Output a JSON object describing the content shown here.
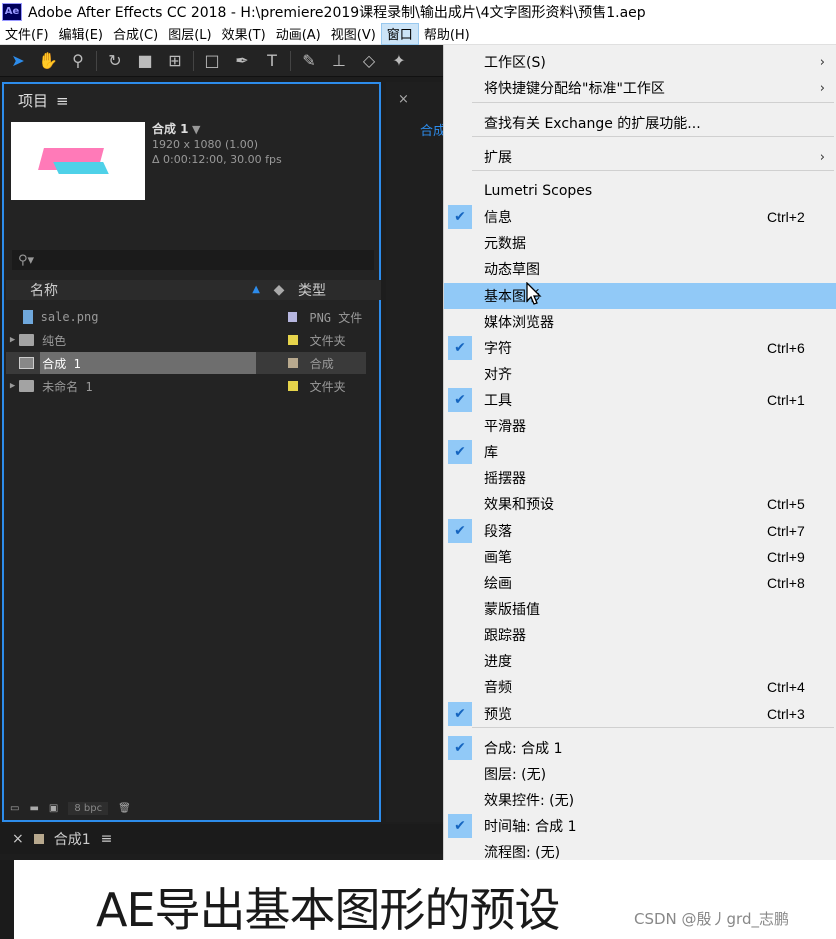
{
  "window": {
    "logo": "Ae",
    "title": "Adobe After Effects CC 2018 - H:\\premiere2019课程录制\\输出成片\\4文字图形资料\\预售1.aep"
  },
  "menubar": {
    "items": [
      "文件(F)",
      "编辑(E)",
      "合成(C)",
      "图层(L)",
      "效果(T)",
      "动画(A)",
      "视图(V)",
      "窗口",
      "帮助(H)"
    ],
    "active_index": 7
  },
  "project": {
    "tab_label": "项目",
    "comp_name": "合成 1",
    "comp_res": "1920 x 1080 (1.00)",
    "comp_duration": "Δ 0:00:12:00, 30.00 fps",
    "search_icon": "⚲▾",
    "col_name": "名称",
    "col_type": "类型",
    "items": [
      {
        "name": "sale.png",
        "type": "PNG 文件",
        "label_color": "#b7b7e0",
        "icon": "png"
      },
      {
        "name": "纯色",
        "type": "文件夹",
        "label_color": "#e6d44b",
        "icon": "folder"
      },
      {
        "name": "合成 1",
        "type": "合成",
        "label_color": "#b8a98e",
        "icon": "comp"
      },
      {
        "name": "未命名 1",
        "type": "文件夹",
        "label_color": "#e6d44b",
        "icon": "folder"
      }
    ],
    "bpc": "8 bpc"
  },
  "mid": {
    "tab": "合成"
  },
  "timeline": {
    "tab_label": "合成1"
  },
  "window_menu": {
    "items": [
      {
        "label": "工作区(S)",
        "shortcut": "",
        "checked": false,
        "submenu": true
      },
      {
        "label": "将快捷键分配给\"标准\"工作区",
        "shortcut": "",
        "checked": false,
        "submenu": true
      },
      {
        "label": "查找有关 Exchange 的扩展功能...",
        "shortcut": "",
        "checked": false,
        "submenu": false
      },
      {
        "label": "扩展",
        "shortcut": "",
        "checked": false,
        "submenu": true
      },
      {
        "label": "Lumetri Scopes",
        "shortcut": "",
        "checked": false,
        "submenu": false
      },
      {
        "label": "信息",
        "shortcut": "Ctrl+2",
        "checked": true,
        "submenu": false
      },
      {
        "label": "元数据",
        "shortcut": "",
        "checked": false,
        "submenu": false
      },
      {
        "label": "动态草图",
        "shortcut": "",
        "checked": false,
        "submenu": false
      },
      {
        "label": "基本图形",
        "shortcut": "",
        "checked": false,
        "submenu": false,
        "highlight": true
      },
      {
        "label": "媒体浏览器",
        "shortcut": "",
        "checked": false,
        "submenu": false
      },
      {
        "label": "字符",
        "shortcut": "Ctrl+6",
        "checked": true,
        "submenu": false
      },
      {
        "label": "对齐",
        "shortcut": "",
        "checked": false,
        "submenu": false
      },
      {
        "label": "工具",
        "shortcut": "Ctrl+1",
        "checked": true,
        "submenu": false
      },
      {
        "label": "平滑器",
        "shortcut": "",
        "checked": false,
        "submenu": false
      },
      {
        "label": "库",
        "shortcut": "",
        "checked": true,
        "submenu": false
      },
      {
        "label": "摇摆器",
        "shortcut": "",
        "checked": false,
        "submenu": false
      },
      {
        "label": "效果和预设",
        "shortcut": "Ctrl+5",
        "checked": false,
        "submenu": false
      },
      {
        "label": "段落",
        "shortcut": "Ctrl+7",
        "checked": true,
        "submenu": false
      },
      {
        "label": "画笔",
        "shortcut": "Ctrl+9",
        "checked": false,
        "submenu": false
      },
      {
        "label": "绘画",
        "shortcut": "Ctrl+8",
        "checked": false,
        "submenu": false
      },
      {
        "label": "蒙版插值",
        "shortcut": "",
        "checked": false,
        "submenu": false
      },
      {
        "label": "跟踪器",
        "shortcut": "",
        "checked": false,
        "submenu": false
      },
      {
        "label": "进度",
        "shortcut": "",
        "checked": false,
        "submenu": false
      },
      {
        "label": "音频",
        "shortcut": "Ctrl+4",
        "checked": false,
        "submenu": false
      },
      {
        "label": "预览",
        "shortcut": "Ctrl+3",
        "checked": true,
        "submenu": false
      },
      {
        "label": "合成: 合成 1",
        "shortcut": "",
        "checked": true,
        "submenu": false
      },
      {
        "label": "图层: (无)",
        "shortcut": "",
        "checked": false,
        "submenu": false
      },
      {
        "label": "效果控件: (无)",
        "shortcut": "",
        "checked": false,
        "submenu": false
      },
      {
        "label": "时间轴: 合成 1",
        "shortcut": "",
        "checked": true,
        "submenu": false
      },
      {
        "label": "流程图: (无)",
        "shortcut": "",
        "checked": false,
        "submenu": false
      }
    ]
  },
  "caption": {
    "text": "AE导出基本图形的预设",
    "watermark": "CSDN @殷丿grd_志鹏"
  },
  "colors": {
    "accent": "#2d8ceb",
    "menu_highlight": "#91c9f7"
  }
}
